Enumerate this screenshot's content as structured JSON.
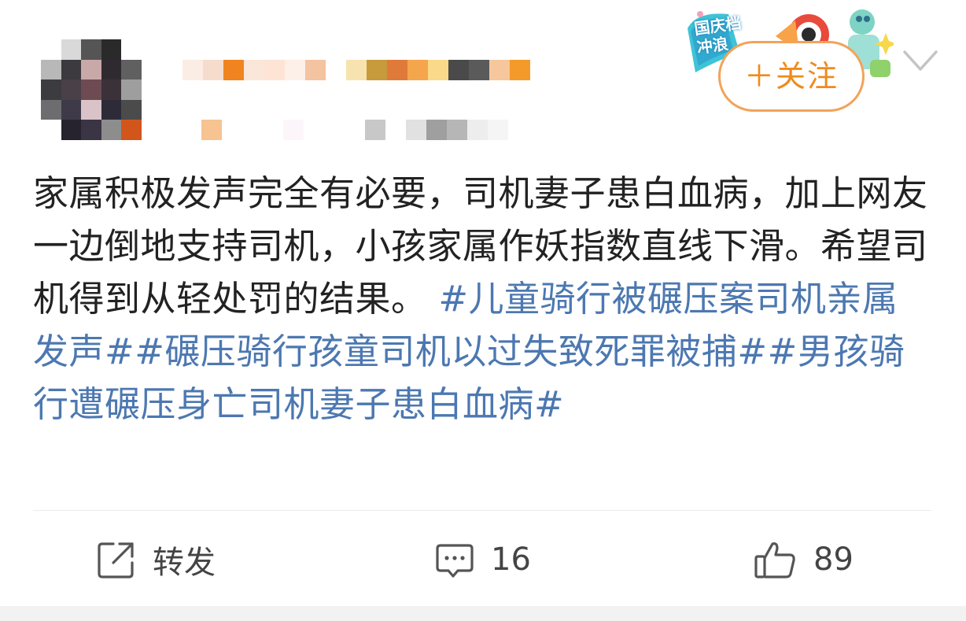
{
  "header": {
    "follow_label": "＋关注",
    "badge_line1": "国庆档",
    "badge_line2": "冲浪"
  },
  "post": {
    "text": "家属积极发声完全有必要，司机妻子患白血病，加上网友一边倒地支持司机，小孩家属作妖指数直线下滑。希望司机得到从轻处罚的结果。",
    "hashtags": [
      "#儿童骑行被碾压案司机亲属发声#",
      "#碾压骑行孩童司机以过失致死罪被捕#",
      "#男孩骑行遭碾压身亡司机妻子患白血病#"
    ]
  },
  "actions": {
    "repost_label": "转发",
    "comment_count": "16",
    "like_count": "89",
    "repost_icon": "share-icon",
    "comment_icon": "comment-icon",
    "like_icon": "thumbs-up-icon"
  },
  "colors": {
    "link": "#4c78b1",
    "follow": "#f08a1c",
    "text": "#222222"
  }
}
